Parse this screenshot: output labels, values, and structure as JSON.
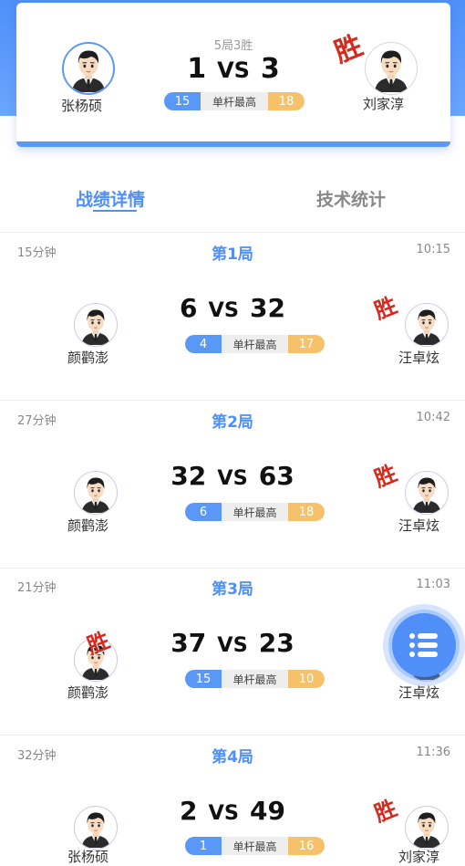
{
  "summary": {
    "format": "5局3胜",
    "left_player": "张杨硕",
    "right_player": "刘家淳",
    "left_score": "1",
    "vs": "VS",
    "right_score": "3",
    "highest_break_label": "单杆最高",
    "left_break": "15",
    "right_break": "18",
    "win_label": "胜",
    "winner_side": "right"
  },
  "tabs": [
    {
      "label": "战绩详情",
      "active": true
    },
    {
      "label": "技术统计",
      "active": false
    }
  ],
  "games": [
    {
      "title": "第1局",
      "duration": "15分钟",
      "time": "10:15",
      "left_player": "颜鹳澎",
      "right_player": "汪卓炫",
      "left_score": "6",
      "right_score": "32",
      "left_break": "4",
      "right_break": "17",
      "winner_side": "right"
    },
    {
      "title": "第2局",
      "duration": "27分钟",
      "time": "10:42",
      "left_player": "颜鹳澎",
      "right_player": "汪卓炫",
      "left_score": "32",
      "right_score": "63",
      "left_break": "6",
      "right_break": "18",
      "winner_side": "right"
    },
    {
      "title": "第3局",
      "duration": "21分钟",
      "time": "11:03",
      "left_player": "颜鹳澎",
      "right_player": "汪卓炫",
      "left_score": "37",
      "right_score": "23",
      "left_break": "15",
      "right_break": "10",
      "winner_side": "left"
    },
    {
      "title": "第4局",
      "duration": "32分钟",
      "time": "11:36",
      "left_player": "张杨硕",
      "right_player": "刘家淳",
      "left_score": "2",
      "right_score": "49",
      "left_break": "1",
      "right_break": "16",
      "winner_side": "right"
    }
  ],
  "icons": {
    "avatar": "cartoon-man-avatar-icon",
    "fab": "list-menu-icon"
  },
  "colors": {
    "accent": "#4f8ff7",
    "left_break": "#5a98f8",
    "right_break": "#f5c26b",
    "win": "#d62a1e"
  }
}
